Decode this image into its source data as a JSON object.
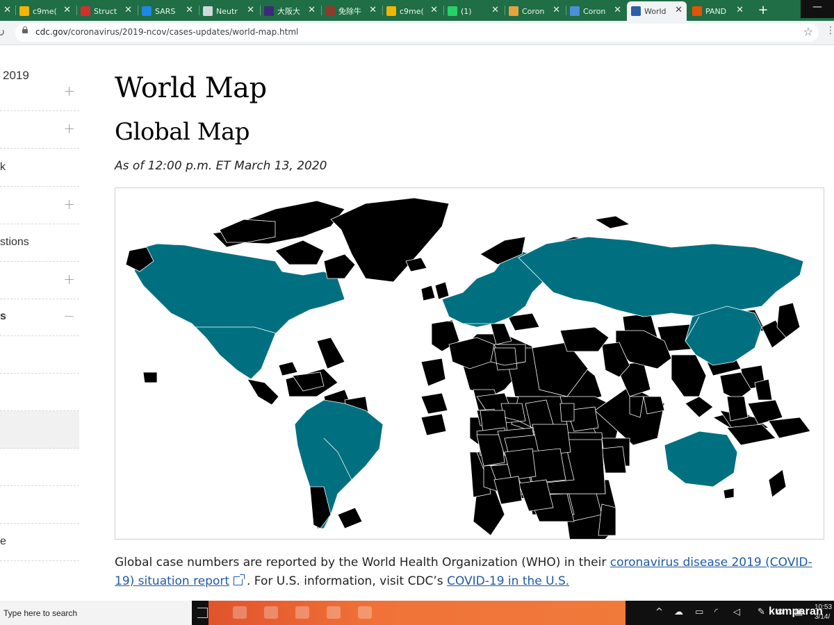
{
  "browser": {
    "tabs": [
      {
        "label": "",
        "favicon": "close-icon",
        "color": "#1f6e45"
      },
      {
        "label": "c9me(",
        "favicon": "drive-icon",
        "color": "#f4b400"
      },
      {
        "label": "Struct",
        "favicon": "scribd-icon",
        "color": "#d32f2f"
      },
      {
        "label": "SARS",
        "favicon": "bird-icon",
        "color": "#1e88e5"
      },
      {
        "label": "Neutr",
        "favicon": "doc-icon",
        "color": "#cfd8dc"
      },
      {
        "label": "大阪大",
        "favicon": "shield-icon",
        "color": "#3b2a7a"
      },
      {
        "label": "免除牛",
        "favicon": "circle-icon",
        "color": "#8d3b2c"
      },
      {
        "label": "c9me(",
        "favicon": "drive-icon",
        "color": "#f4b400"
      },
      {
        "label": "(1)",
        "favicon": "whatsapp-icon",
        "color": "#25d366"
      },
      {
        "label": "Coron",
        "favicon": "lab-icon",
        "color": "#e6a23c"
      },
      {
        "label": "Coron",
        "favicon": "globe-icon",
        "color": "#4a90d9"
      },
      {
        "label": "World",
        "favicon": "cdc-icon",
        "color": "#2d5fa8",
        "active": true
      },
      {
        "label": "PAND",
        "favicon": "cross-icon",
        "color": "#e65100"
      }
    ],
    "new_tab_label": "+",
    "minimize_label": "—",
    "url_host": "cdc.gov",
    "url_path": "/coronavirus/2019-ncov/cases-updates/world-map.html"
  },
  "sidebar": {
    "title": "2019",
    "items": [
      {
        "label": "",
        "toggle": "+"
      },
      {
        "label": "",
        "toggle": "+"
      },
      {
        "label": "k",
        "toggle": ""
      },
      {
        "label": "",
        "toggle": "+"
      },
      {
        "label": "stions",
        "toggle": ""
      },
      {
        "label": "",
        "toggle": "+"
      },
      {
        "label": "s",
        "toggle": "−"
      },
      {
        "label": "",
        "toggle": ""
      },
      {
        "label": "",
        "toggle": ""
      },
      {
        "label": "",
        "toggle": ""
      },
      {
        "label": "",
        "toggle": ""
      },
      {
        "label": "",
        "toggle": ""
      },
      {
        "label": "e",
        "toggle": ""
      }
    ]
  },
  "main": {
    "title": "World Map",
    "section_title": "Global Map",
    "as_of": "As of 12:00 p.m. ET March 13, 2020",
    "caption_prefix": "Global case numbers are reported by the World Health Organization (WHO) in their ",
    "caption_link1": "coronavirus disease 2019 (COVID-19) situation report",
    "caption_middle": ". For U.S. information, visit CDC’s ",
    "caption_link2": "COVID-19 in the U.S."
  },
  "map": {
    "affected_color": "#007080",
    "unaffected_color": "#e0e0e0"
  },
  "taskbar": {
    "search_placeholder": "Type here to search",
    "brand": "kumparan",
    "clock_time": "10:53",
    "clock_date": "3/14/"
  }
}
